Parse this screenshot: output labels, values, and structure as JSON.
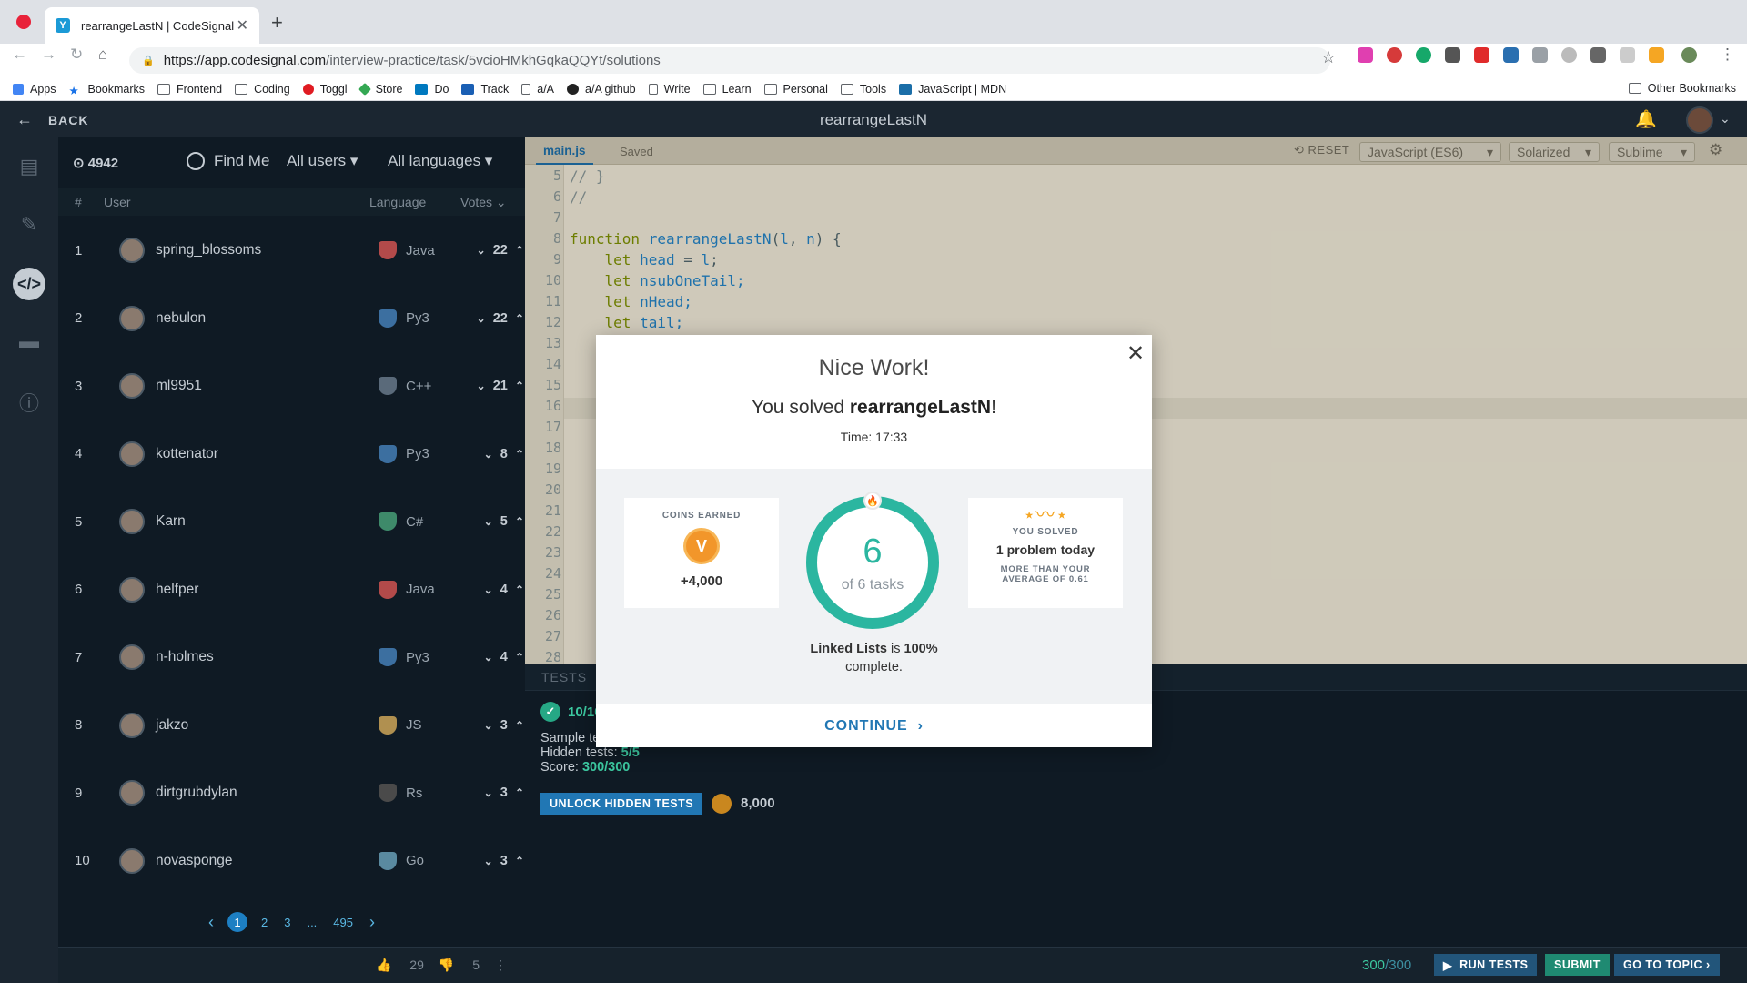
{
  "browser": {
    "tab_title": "rearrangeLastN | CodeSignal",
    "url_host": "https://app.codesignal.com",
    "url_path": "/interview-practice/task/5vcioHMkhGqkaQQYt/solutions",
    "bookmarks": [
      "Apps",
      "Bookmarks",
      "Frontend",
      "Coding",
      "Toggl",
      "Store",
      "Do",
      "Track",
      "a/A",
      "a/A github",
      "Write",
      "Learn",
      "Personal",
      "Tools",
      "JavaScript | MDN"
    ],
    "other_bookmarks": "Other Bookmarks"
  },
  "header": {
    "back_label": "BACK",
    "title": "rearrangeLastN"
  },
  "leaderboard": {
    "count": "4942",
    "find_me": "Find Me",
    "filter_users": "All users",
    "filter_languages": "All languages",
    "columns": {
      "rank": "#",
      "user": "User",
      "language": "Language",
      "votes": "Votes"
    },
    "rows": [
      {
        "rank": "1",
        "user": "spring_blossoms",
        "lang": "Java",
        "votes": "22"
      },
      {
        "rank": "2",
        "user": "nebulon",
        "lang": "Py3",
        "votes": "22"
      },
      {
        "rank": "3",
        "user": "ml9951",
        "lang": "C++",
        "votes": "21"
      },
      {
        "rank": "4",
        "user": "kottenator",
        "lang": "Py3",
        "votes": "8"
      },
      {
        "rank": "5",
        "user": "Karn",
        "lang": "C#",
        "votes": "5"
      },
      {
        "rank": "6",
        "user": "helfper",
        "lang": "Java",
        "votes": "4"
      },
      {
        "rank": "7",
        "user": "n-holmes",
        "lang": "Py3",
        "votes": "4"
      },
      {
        "rank": "8",
        "user": "jakzo",
        "lang": "JS",
        "votes": "3"
      },
      {
        "rank": "9",
        "user": "dirtgrubdylan",
        "lang": "Rs",
        "votes": "3"
      },
      {
        "rank": "10",
        "user": "novasponge",
        "lang": "Go",
        "votes": "3"
      }
    ],
    "pages": [
      "1",
      "2",
      "3",
      "...",
      "495"
    ],
    "likes": "29",
    "dislikes": "5"
  },
  "editor": {
    "file_tab": "main.js",
    "status": "Saved",
    "reset_label": "RESET",
    "language": "JavaScript (ES6)",
    "theme": "Solarized",
    "keymap": "Sublime",
    "line_numbers": [
      "5",
      "6",
      "7",
      "8",
      "9",
      "10",
      "11",
      "12",
      "13",
      "14",
      "15",
      "16",
      "17",
      "18",
      "19",
      "20",
      "21",
      "22",
      "23",
      "24",
      "25",
      "26",
      "27",
      "28"
    ],
    "code_lines": [
      "// }",
      "//",
      "",
      "function rearrangeLastN(l, n) {",
      "    let head = l;",
      "    let nsubOneTail;",
      "    let nHead;",
      "    let tail;"
    ]
  },
  "tests": {
    "header": "TESTS",
    "summary": "10/10",
    "sample_label": "Sample tests:",
    "hidden_label": "Hidden tests:",
    "hidden_value": "5/5",
    "score_label": "Score:",
    "score_value": "300/300",
    "unlock_label": "UNLOCK HIDDEN TESTS",
    "coins": "8,000"
  },
  "footer": {
    "score": "300",
    "score_total": "/300",
    "run_tests": "RUN TESTS",
    "submit": "SUBMIT",
    "go_to_topic": "GO TO TOPIC"
  },
  "modal": {
    "title": "Nice Work!",
    "solved_prefix": "You solved ",
    "solved_task": "rearrangeLastN",
    "solved_suffix": "!",
    "time": "Time: 17:33",
    "coins_caption": "COINS EARNED",
    "coins_value": "+4,000",
    "ring_number": "6",
    "ring_sub": "of 6 tasks",
    "topic": "Linked Lists",
    "topic_mid": " is ",
    "topic_pct": "100%",
    "topic_end": "complete.",
    "solved_caption": "YOU SOLVED",
    "solved_today": "1 problem today",
    "average_note": "MORE THAN YOUR AVERAGE OF 0.61",
    "continue_label": "CONTINUE"
  },
  "colors": {
    "accent": "#2177b4",
    "success": "#2bb6a0",
    "dark_bg": "#0f1a24"
  }
}
